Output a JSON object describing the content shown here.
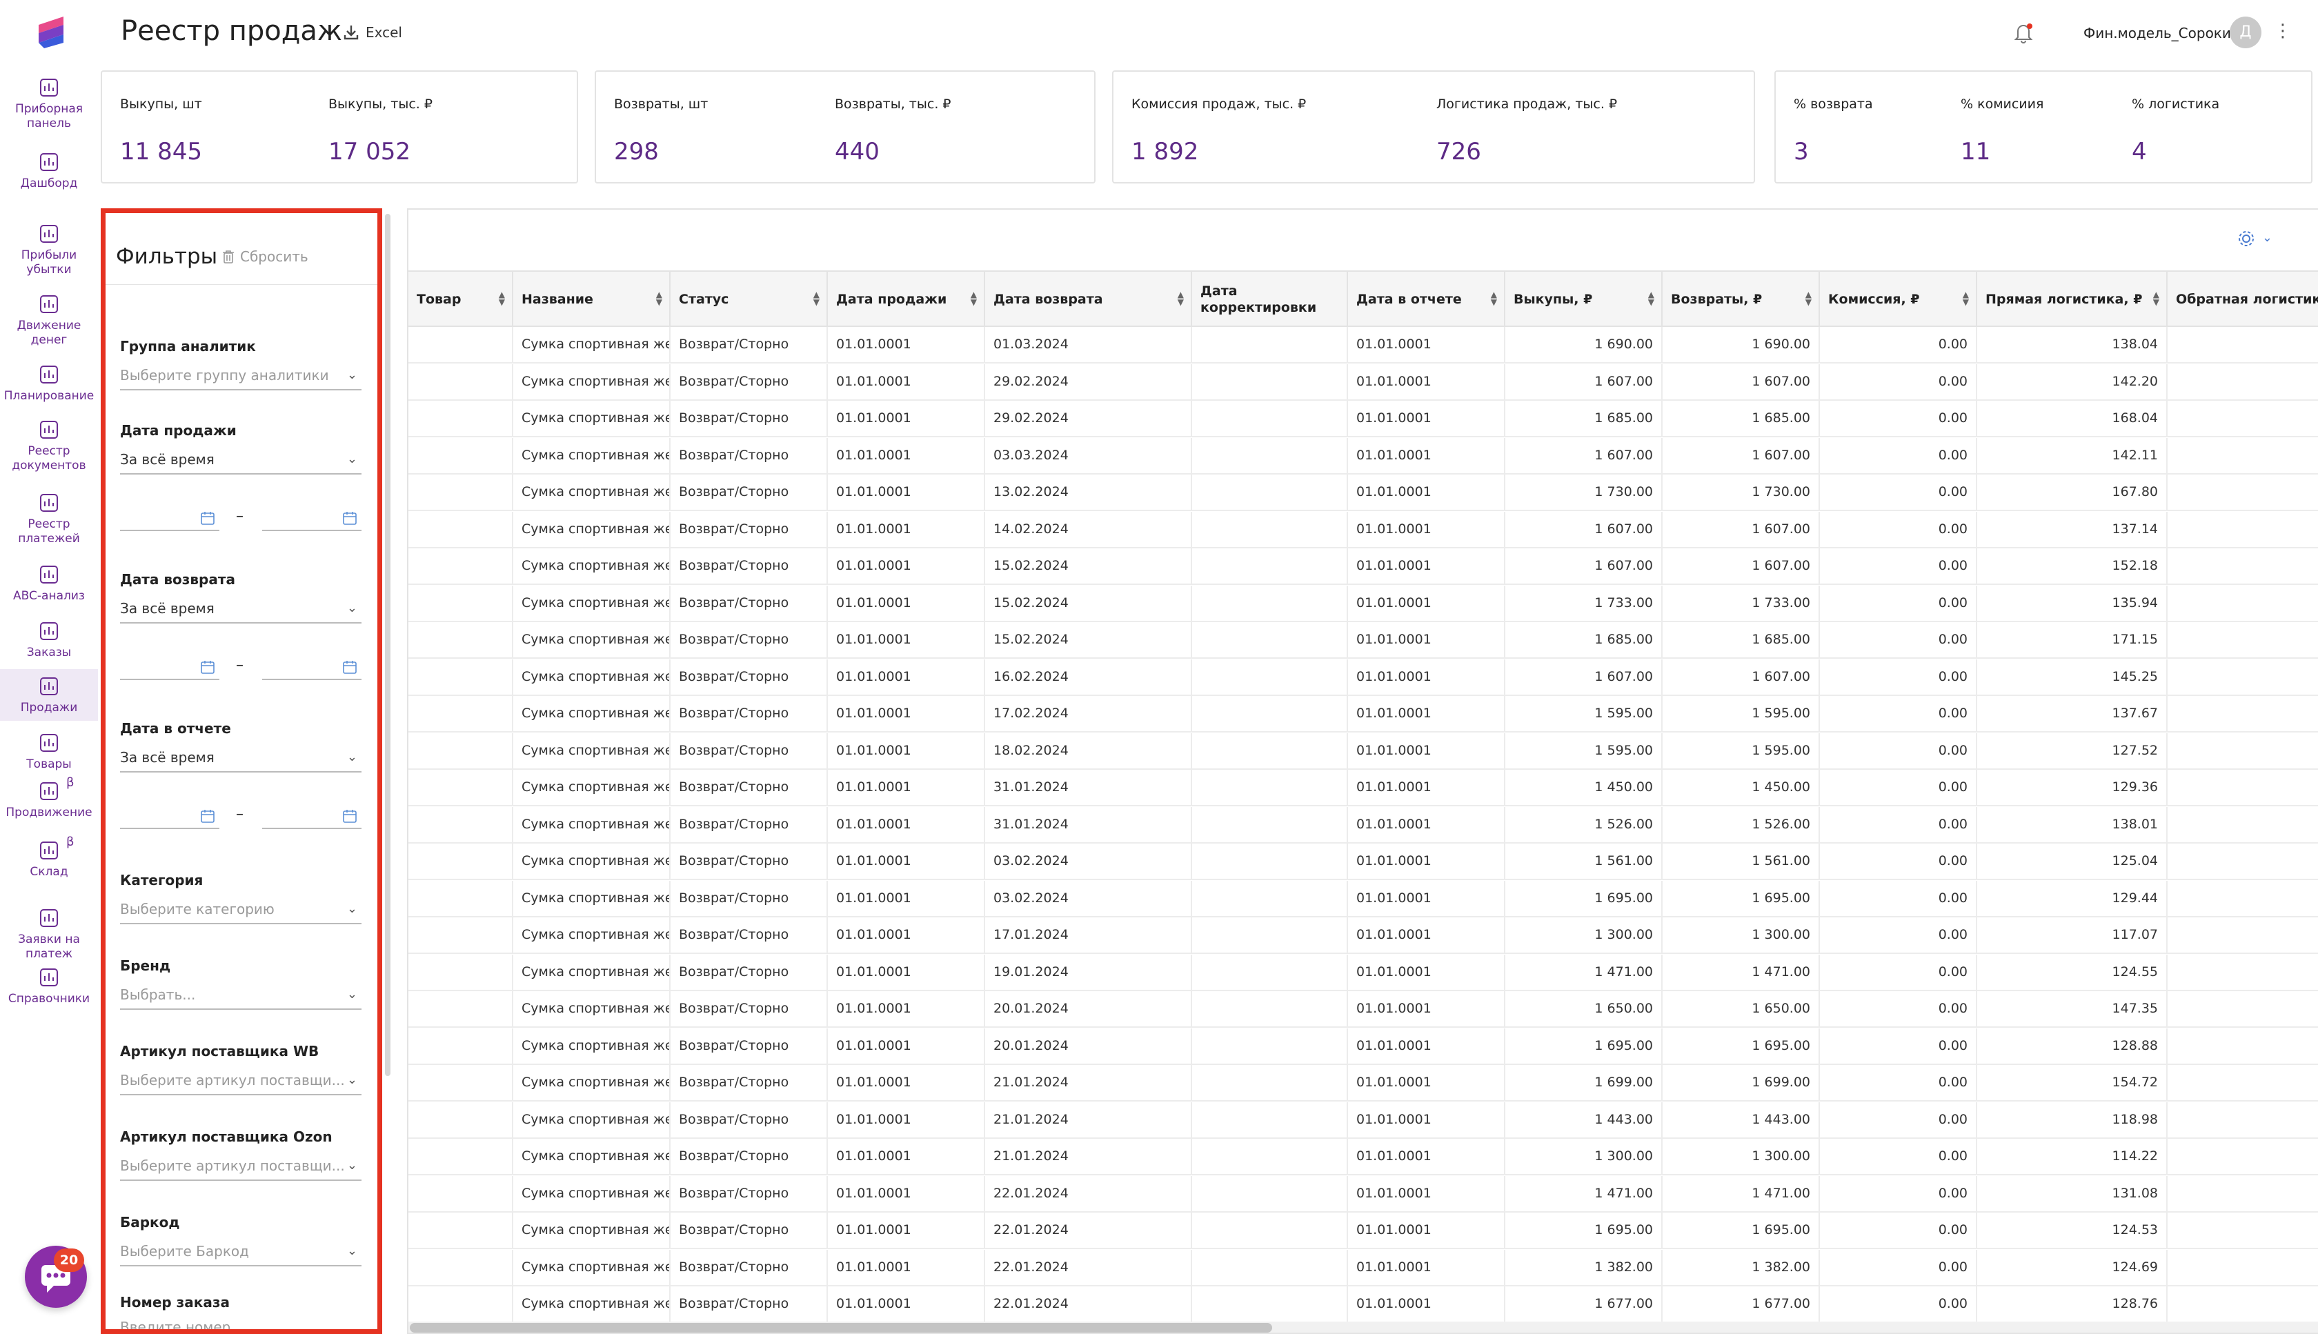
{
  "nav": [
    {
      "label1": "Приборная",
      "label2": "панель",
      "icon": "dashboard-panel-icon"
    },
    {
      "label1": "Дашборд",
      "label2": "",
      "icon": "pie-chart-icon"
    },
    {
      "label1": "Прибыли",
      "label2": "убытки",
      "icon": "bar-chart-icon"
    },
    {
      "label1": "Движение",
      "label2": "денег",
      "icon": "money-flow-icon"
    },
    {
      "label1": "Планирование",
      "label2": "",
      "icon": "target-icon"
    },
    {
      "label1": "Реестр",
      "label2": "документов",
      "icon": "documents-icon"
    },
    {
      "label1": "Реестр",
      "label2": "платежей",
      "icon": "payments-icon"
    },
    {
      "label1": "ABC-анализ",
      "label2": "",
      "icon": "abc-icon"
    },
    {
      "label1": "Заказы",
      "label2": "",
      "icon": "shopping-bag-icon"
    },
    {
      "label1": "Продажи",
      "label2": "",
      "icon": "dollar-circle-icon"
    },
    {
      "label1": "Товары",
      "label2": "",
      "icon": "boxes-icon"
    },
    {
      "label1": "Продвижение",
      "label2": "",
      "icon": "megaphone-icon",
      "beta": "β"
    },
    {
      "label1": "Склад",
      "label2": "",
      "icon": "warehouse-icon",
      "beta": "β"
    },
    {
      "label1": "Заявки на",
      "label2": "платеж",
      "icon": "payment-request-icon"
    },
    {
      "label1": "Справочники",
      "label2": "",
      "icon": "folder-icon"
    }
  ],
  "chat_badge": "20",
  "header": {
    "title": "Реестр продаж",
    "excel_label": "Excel",
    "user_name": "Фин.модель_Сороки...",
    "avatar_letter": "Д",
    "kebab": "⋮"
  },
  "kpis": {
    "buyouts_qty_label": "Выкупы, шт",
    "buyouts_qty_value": "11 845",
    "buyouts_sum_label": "Выкупы, тыс. ₽",
    "buyouts_sum_value": "17 052",
    "returns_qty_label": "Возвраты, шт",
    "returns_qty_value": "298",
    "returns_sum_label": "Возвраты, тыс. ₽",
    "returns_sum_value": "440",
    "commission_label": "Комиссия продаж, тыс. ₽",
    "commission_value": "1 892",
    "logistics_label": "Логистика продаж, тыс. ₽",
    "logistics_value": "726",
    "return_pct_label": "% возврата",
    "return_pct_value": "3",
    "commission_pct_label": "% комисиия",
    "commission_pct_value": "11",
    "logistics_pct_label": "% логистика",
    "logistics_pct_value": "4"
  },
  "filters": {
    "title": "Фильтры",
    "reset_label": "Сбросить",
    "group_label": "Группа аналитик",
    "group_placeholder": "Выберите группу аналитики",
    "sale_date_label": "Дата продажи",
    "sale_date_value": "За всё время",
    "return_date_label": "Дата возврата",
    "return_date_value": "За всё время",
    "report_date_label": "Дата в отчете",
    "report_date_value": "За всё время",
    "dash": "–",
    "category_label": "Категория",
    "category_placeholder": "Выберите категорию",
    "brand_label": "Бренд",
    "brand_placeholder": "Выбрать...",
    "article_wb_label": "Артикул поставщика WB",
    "article_wb_placeholder": "Выберите артикул поставщи...",
    "article_ozon_label": "Артикул поставщика Ozon",
    "article_ozon_placeholder": "Выберите артикул поставщи...",
    "barcode_label": "Баркод",
    "barcode_placeholder": "Выберите Баркод",
    "order_label": "Номер заказа",
    "order_placeholder": "Введите номер"
  },
  "table": {
    "columns": [
      "Товар",
      "Название",
      "Статус",
      "Дата продажи",
      "Дата возврата",
      "Дата корректировки",
      "Дата в отчете",
      "Выкупы, ₽",
      "Возвраты, ₽",
      "Комиссия, ₽",
      "Прямая логистика, ₽",
      "Обратная логистика"
    ],
    "common": {
      "name": "Сумка спортивная же",
      "status": "Возврат/Сторно",
      "sale_date": "01.01.0001",
      "report_date": "01.01.0001",
      "commission": "0.00"
    },
    "rows": [
      {
        "return_date": "01.03.2024",
        "buyout": "1 690.00",
        "returns": "1 690.00",
        "logistics": "138.04"
      },
      {
        "return_date": "29.02.2024",
        "buyout": "1 607.00",
        "returns": "1 607.00",
        "logistics": "142.20"
      },
      {
        "return_date": "29.02.2024",
        "buyout": "1 685.00",
        "returns": "1 685.00",
        "logistics": "168.04"
      },
      {
        "return_date": "03.03.2024",
        "buyout": "1 607.00",
        "returns": "1 607.00",
        "logistics": "142.11"
      },
      {
        "return_date": "13.02.2024",
        "buyout": "1 730.00",
        "returns": "1 730.00",
        "logistics": "167.80"
      },
      {
        "return_date": "14.02.2024",
        "buyout": "1 607.00",
        "returns": "1 607.00",
        "logistics": "137.14"
      },
      {
        "return_date": "15.02.2024",
        "buyout": "1 607.00",
        "returns": "1 607.00",
        "logistics": "152.18"
      },
      {
        "return_date": "15.02.2024",
        "buyout": "1 733.00",
        "returns": "1 733.00",
        "logistics": "135.94"
      },
      {
        "return_date": "15.02.2024",
        "buyout": "1 685.00",
        "returns": "1 685.00",
        "logistics": "171.15"
      },
      {
        "return_date": "16.02.2024",
        "buyout": "1 607.00",
        "returns": "1 607.00",
        "logistics": "145.25"
      },
      {
        "return_date": "17.02.2024",
        "buyout": "1 595.00",
        "returns": "1 595.00",
        "logistics": "137.67"
      },
      {
        "return_date": "18.02.2024",
        "buyout": "1 595.00",
        "returns": "1 595.00",
        "logistics": "127.52"
      },
      {
        "return_date": "31.01.2024",
        "buyout": "1 450.00",
        "returns": "1 450.00",
        "logistics": "129.36"
      },
      {
        "return_date": "31.01.2024",
        "buyout": "1 526.00",
        "returns": "1 526.00",
        "logistics": "138.01"
      },
      {
        "return_date": "03.02.2024",
        "buyout": "1 561.00",
        "returns": "1 561.00",
        "logistics": "125.04"
      },
      {
        "return_date": "03.02.2024",
        "buyout": "1 695.00",
        "returns": "1 695.00",
        "logistics": "129.44"
      },
      {
        "return_date": "17.01.2024",
        "buyout": "1 300.00",
        "returns": "1 300.00",
        "logistics": "117.07"
      },
      {
        "return_date": "19.01.2024",
        "buyout": "1 471.00",
        "returns": "1 471.00",
        "logistics": "124.55"
      },
      {
        "return_date": "20.01.2024",
        "buyout": "1 650.00",
        "returns": "1 650.00",
        "logistics": "147.35"
      },
      {
        "return_date": "20.01.2024",
        "buyout": "1 695.00",
        "returns": "1 695.00",
        "logistics": "128.88"
      },
      {
        "return_date": "21.01.2024",
        "buyout": "1 699.00",
        "returns": "1 699.00",
        "logistics": "154.72"
      },
      {
        "return_date": "21.01.2024",
        "buyout": "1 443.00",
        "returns": "1 443.00",
        "logistics": "118.98"
      },
      {
        "return_date": "21.01.2024",
        "buyout": "1 300.00",
        "returns": "1 300.00",
        "logistics": "114.22"
      },
      {
        "return_date": "22.01.2024",
        "buyout": "1 471.00",
        "returns": "1 471.00",
        "logistics": "131.08"
      },
      {
        "return_date": "22.01.2024",
        "buyout": "1 695.00",
        "returns": "1 695.00",
        "logistics": "124.53"
      },
      {
        "return_date": "22.01.2024",
        "buyout": "1 382.00",
        "returns": "1 382.00",
        "logistics": "124.69"
      },
      {
        "return_date": "22.01.2024",
        "buyout": "1 677.00",
        "returns": "1 677.00",
        "logistics": "128.76"
      }
    ]
  },
  "colors": {
    "accent": "#5d2a86",
    "highlight": "#e53221",
    "nav_text": "#6a2c91"
  }
}
